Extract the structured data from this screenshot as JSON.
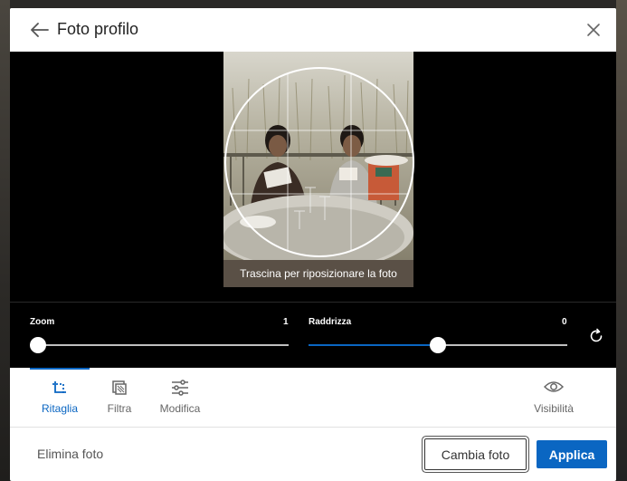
{
  "header": {
    "title": "Foto profilo"
  },
  "editor": {
    "drag_hint": "Trascina per riposizionare la foto",
    "zoom": {
      "label": "Zoom",
      "value_text": "1",
      "value_fraction": 0.0
    },
    "straighten": {
      "label": "Raddrizza",
      "value_text": "0",
      "value_fraction": 0.5
    }
  },
  "tabs": [
    {
      "label": "Ritaglia",
      "icon": "crop-icon",
      "active": true
    },
    {
      "label": "Filtra",
      "icon": "filter-icon",
      "active": false
    },
    {
      "label": "Modifica",
      "icon": "adjust-icon",
      "active": false
    },
    {
      "label": "Visibilità",
      "icon": "eye-icon",
      "active": false
    }
  ],
  "footer": {
    "delete_label": "Elimina foto",
    "change_label": "Cambia foto",
    "apply_label": "Applica"
  },
  "colors": {
    "accent": "#0a66c2",
    "editor_bg": "#000000"
  }
}
